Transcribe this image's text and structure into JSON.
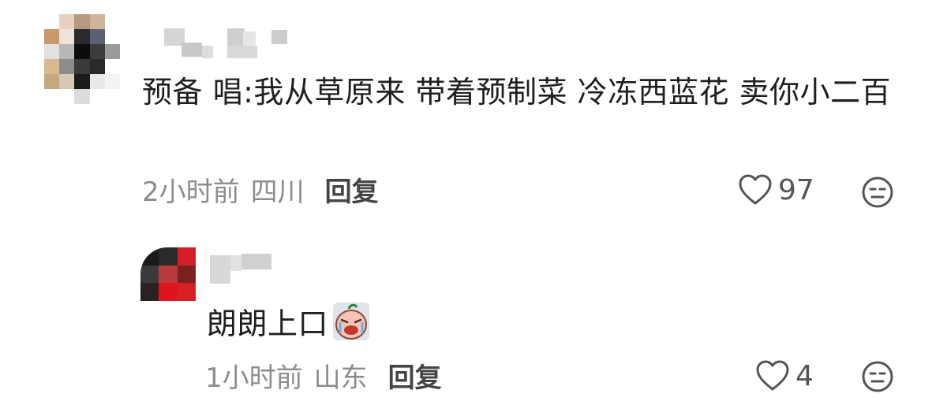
{
  "comments": [
    {
      "text": "预备 唱:我从草原来 带着预制菜 冷冻西蓝花 卖你小二百",
      "time": "2小时前",
      "location": "四川",
      "reply_label": "回复",
      "likes": "97"
    },
    {
      "text": "朗朗上口",
      "time": "1小时前",
      "location": "山东",
      "reply_label": "回复",
      "likes": "4"
    }
  ],
  "icons": {
    "like": "heart-outline-icon",
    "react": "emoji-face-icon",
    "sticker": "crying-face-sticker-icon"
  },
  "colors": {
    "text": "#1f1f1f",
    "meta": "#8d8d8d",
    "reply": "#444444",
    "icon": "#555555"
  }
}
